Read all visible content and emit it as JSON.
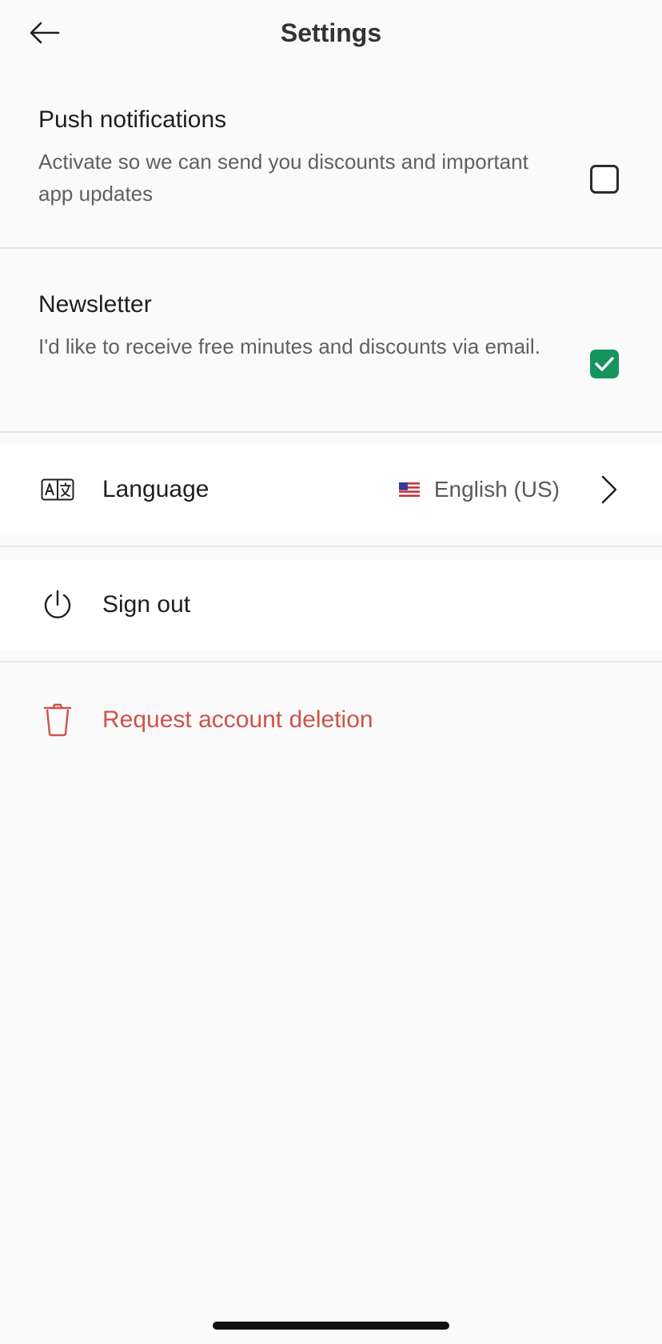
{
  "header": {
    "title": "Settings",
    "back_icon": "arrow-left-icon"
  },
  "toggles": {
    "push": {
      "title": "Push notifications",
      "description": "Activate so we can send you discounts and important app updates",
      "checked": false
    },
    "newsletter": {
      "title": "Newsletter",
      "description": "I'd like to receive free minutes and discounts via email.",
      "checked": true
    }
  },
  "language": {
    "label": "Language",
    "value": "English (US)",
    "icon": "translate-icon",
    "flag": "us-flag-icon",
    "chevron": "chevron-right-icon"
  },
  "sign_out": {
    "label": "Sign out",
    "icon": "power-icon"
  },
  "delete_account": {
    "label": "Request account deletion",
    "icon": "trash-icon"
  },
  "colors": {
    "accent_green": "#17935c",
    "danger_red": "#d0524a",
    "background": "#fafafa",
    "divider": "#e6e6e6"
  }
}
